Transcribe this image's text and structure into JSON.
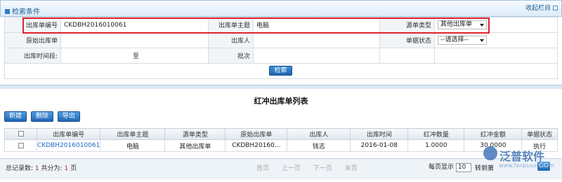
{
  "panel": {
    "title": "检索条件",
    "collapse_label": "收起栏目"
  },
  "form": {
    "out_no_label": "出库单编号",
    "out_no_value": "CKDBH2016010061",
    "subject_label": "出库单主题",
    "subject_value": "电脑",
    "source_type_label": "源单类型",
    "source_type_value": "其他出库单",
    "orig_label": "原始出库单",
    "person_label": "出库人",
    "status_label": "单据状态",
    "status_value": "--请选择--",
    "time_label": "出库时间段:",
    "time_to": "至",
    "batch_label": "批次",
    "search_button": "检索"
  },
  "list": {
    "title": "红冲出库单列表",
    "toolbar": [
      "新建",
      "删除",
      "导出"
    ],
    "headers": [
      "出库单编号",
      "出库单主题",
      "源单类型",
      "原始出库单",
      "出库人",
      "出库时间",
      "红冲数量",
      "红冲金额",
      "单据状态"
    ],
    "rows": [
      [
        "CKDBH2016010061",
        "电脑",
        "其他出库单",
        "CKDBH20160...",
        "钱志",
        "2016-01-08",
        "1.0000",
        "30.0000",
        "执行"
      ]
    ]
  },
  "pager": {
    "total_label": "总记录数:",
    "total_value": "1",
    "pages_label": "共分为:",
    "pages_value": "1",
    "pages_unit": "页",
    "first": "首页",
    "prev": "上一页",
    "next": "下一页",
    "last": "末页",
    "page_size_label": "每页显示",
    "page_size_value": "10",
    "jump_label": "转到第",
    "go_label": "GO"
  },
  "watermark": {
    "brand": "泛普软件",
    "url": "www.fanpusoft.com"
  },
  "colors": {
    "accent": "#2367b5",
    "highlight_box": "#e0232b",
    "link": "#1a6bc0"
  }
}
